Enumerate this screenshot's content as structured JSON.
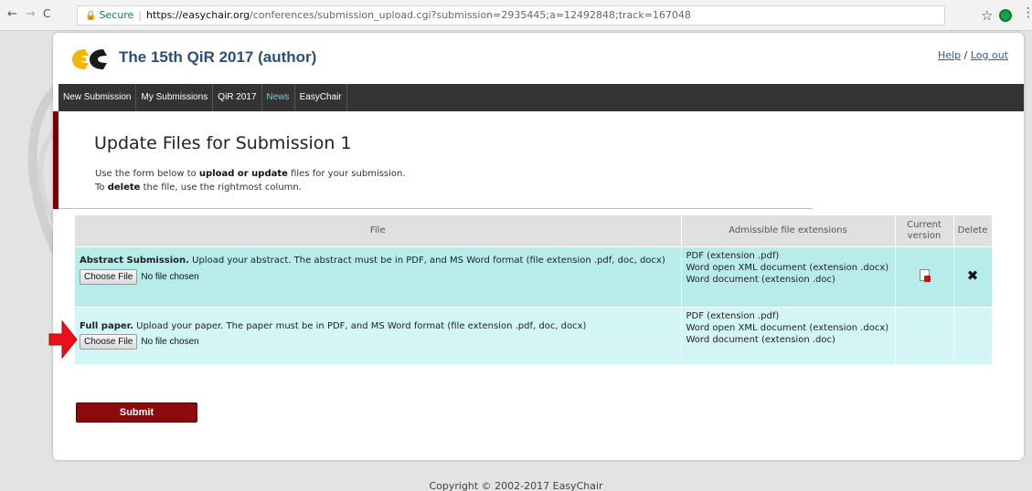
{
  "browser": {
    "back_icon": "back-arrow-icon",
    "back_glyph": "←",
    "forward_glyph": "→",
    "reload_glyph": "C",
    "secure_label": "Secure",
    "url_host": "https://easychair.org",
    "url_rest": "/conferences/submission_upload.cgi?submission=2935445;a=12492848;track=167048",
    "star_glyph": "☆",
    "menu_glyph": "⋮"
  },
  "header": {
    "title": "The 15th QiR 2017 (author)",
    "help_link": "Help",
    "separator": " / ",
    "logout_link": "Log out"
  },
  "menu": {
    "items": [
      "New Submission",
      "My Submissions",
      "QiR 2017",
      "News",
      "EasyChair"
    ],
    "active": "News"
  },
  "page": {
    "title": "Update Files for Submission 1",
    "intro_line1_pre": "Use the form below to ",
    "intro_line1_bold": "upload or update",
    "intro_line1_post": " files for your submission.",
    "intro_line2_pre": "To ",
    "intro_line2_bold": "delete",
    "intro_line2_post": " the file, use the rightmost column."
  },
  "table": {
    "headers": {
      "file": "File",
      "extensions": "Admissible file extensions",
      "current": "Current version",
      "delete": "Delete"
    },
    "rows": [
      {
        "name": "Abstract Submission.",
        "description": " Upload your abstract. The abstract must be in PDF, and MS Word format (file extension .pdf, doc, docx)",
        "choose_label": "Choose File",
        "status": "No file chosen",
        "extensions": [
          "PDF (extension .pdf)",
          "Word open XML document (extension .docx)",
          "Word document (extension .doc)"
        ],
        "current_icon": "pdf-file-icon",
        "delete_glyph": "✖"
      },
      {
        "name": "Full paper.",
        "description": " Upload your paper. The paper must be in PDF, and MS Word format (file extension .pdf, doc, docx)",
        "choose_label": "Choose File",
        "status": "No file chosen",
        "extensions": [
          "PDF (extension .pdf)",
          "Word open XML document (extension .docx)",
          "Word document (extension .doc)"
        ]
      }
    ]
  },
  "submit_label": "Submit",
  "footer": {
    "copyright": "Copyright © 2002-2017 EasyChair"
  },
  "colors": {
    "menubar": "#333333",
    "accent": "#7a0000",
    "submit": "#8c0a0a",
    "row1": "#b8eceb",
    "row2": "#d3f5f5",
    "arrow": "#e8111b"
  }
}
